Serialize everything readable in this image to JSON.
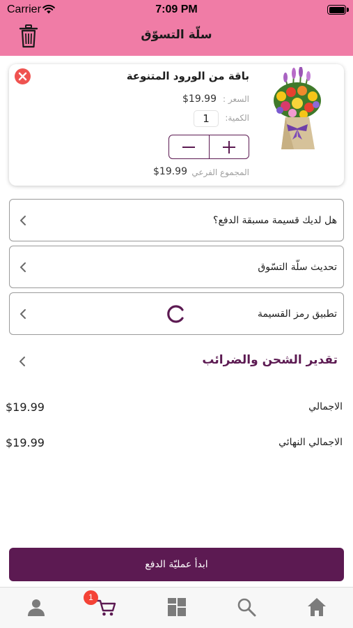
{
  "status_bar": {
    "carrier": "Carrier",
    "time": "7:09 PM"
  },
  "header": {
    "title": "سلّة التسوّق"
  },
  "cart_item": {
    "name": "باقة من الورود المتنوعة",
    "price_label": "السعر :",
    "price": "$19.99",
    "quantity_label": "الكمية:",
    "quantity": "1",
    "subtotal_label": "المجموع الفرعي",
    "subtotal": "$19.99"
  },
  "actions": [
    {
      "label": "هل لديك قسيمة مسبقة الدفع؟"
    },
    {
      "label": "تحديث سلّة التسّوق"
    },
    {
      "label": "تطبيق رمز القسيمة"
    }
  ],
  "shipping": {
    "label": "تقدير الشحن والضرائب"
  },
  "summary": {
    "total_label": "الاجمالي",
    "total": "$19.99",
    "grand_total_label": "الاجمالي النهائي",
    "grand_total": "$19.99"
  },
  "checkout": {
    "label": "ابدأ عمليّة الدفع"
  },
  "tab_bar": {
    "cart_badge": "1",
    "active_tab": "cart"
  },
  "colors": {
    "header": "#f07ca6",
    "brand": "#5c1a52",
    "badge": "#f44336",
    "remove": "#ef5350"
  },
  "icons": [
    "wifi-icon",
    "battery-icon",
    "trash-icon",
    "close-icon",
    "minus-icon",
    "plus-icon",
    "chevron-left-icon",
    "spinner-icon",
    "profile-icon",
    "cart-icon",
    "categories-icon",
    "search-icon",
    "home-icon"
  ]
}
